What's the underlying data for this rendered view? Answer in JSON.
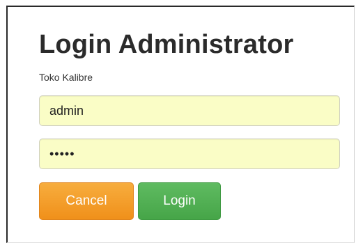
{
  "login_form": {
    "title": "Login Administrator",
    "subtitle": "Toko Kalibre",
    "username": {
      "value": "admin",
      "placeholder": ""
    },
    "password": {
      "value": "12345",
      "placeholder": ""
    },
    "buttons": {
      "cancel_label": "Cancel",
      "login_label": "Login"
    }
  },
  "colors": {
    "field_background": "#fafdc6",
    "cancel_button": "#f0961f",
    "login_button": "#4cad4e",
    "title_text": "#2b2b2b"
  }
}
